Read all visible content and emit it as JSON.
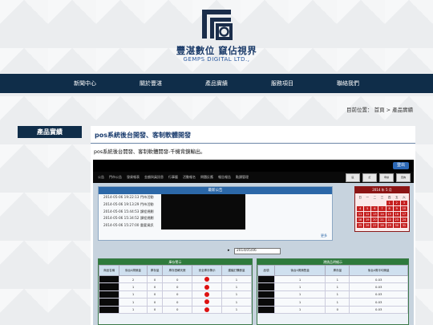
{
  "brand": {
    "name_zh": "豐湛數位 竄佔視界",
    "name_en": "GEMPS DIGITAL LTD.,"
  },
  "nav": [
    {
      "label": "新聞中心"
    },
    {
      "label": "關於豐湛"
    },
    {
      "label": "產品實績"
    },
    {
      "label": "服務項目"
    },
    {
      "label": "聯絡我們"
    }
  ],
  "breadcrumb": "目前位置： 首頁 > 產品實績",
  "sidebar": {
    "title": "產品實績"
  },
  "article": {
    "title": "pos系統後台開發、客制軟體開發",
    "description": "pos系統後台開發、客制軟體開發-千機背鏡輸出。"
  },
  "screenshot": {
    "top_button": "登出",
    "menu": [
      "公告",
      "門市公告",
      "發貨報表",
      "金額與員訊息",
      "行事曆",
      "活動報名",
      "問題反應",
      "報告報告",
      "點讀管理"
    ],
    "menu_icons": [
      "區",
      "訂",
      "申請",
      "查詢"
    ],
    "news": {
      "heading": "最新公告",
      "rows": [
        {
          "time": "2014-05-06 19:22:13",
          "type": "門市活動"
        },
        {
          "time": "2014-05-06 19:13:29",
          "type": "門市活動"
        },
        {
          "time": "2014-05-06 15:44:53",
          "type": "課程規劃"
        },
        {
          "time": "2014-05-06 15:34:52",
          "type": "課程規劃"
        },
        {
          "time": "2014-05-06 15:27:00",
          "type": "重要資訊"
        }
      ],
      "more": "更多"
    },
    "calendar": {
      "heading": "2014 年 5 月",
      "weekdays": [
        "日",
        "一",
        "二",
        "三",
        "四",
        "五",
        "六"
      ],
      "days": [
        "",
        "",
        "",
        "",
        "1",
        "2",
        "3",
        "4",
        "5",
        "6",
        "7",
        "8",
        "9",
        "10",
        "11",
        "12",
        "13",
        "14",
        "15",
        "16",
        "17",
        "18",
        "19",
        "20",
        "21",
        "22",
        "23",
        "24",
        "25",
        "26",
        "27",
        "28",
        "29",
        "30",
        "31"
      ]
    },
    "date_value": "2014/05/06",
    "stock": {
      "heading": "庫存警示",
      "headers": [
        "商品名稱",
        "後台4周銷量",
        "庫存量",
        "庫存週轉天數",
        "安全庫存警示",
        "建議訂購數量"
      ],
      "rows": [
        {
          "a": "2",
          "b": "0",
          "c": "0",
          "d": "1"
        },
        {
          "a": "1",
          "b": "0",
          "c": "0",
          "d": "1"
        },
        {
          "a": "1",
          "b": "0",
          "c": "0",
          "d": "1"
        },
        {
          "a": "1",
          "b": "0",
          "c": "0",
          "d": "1"
        },
        {
          "a": "1",
          "b": "0",
          "c": "0",
          "d": "1"
        }
      ]
    },
    "sales": {
      "heading": "滯銷品明細示",
      "headers": [
        "品項",
        "後台4周銷售量",
        "庫存量",
        "後台4周平均銷量"
      ],
      "rows": [
        {
          "a": "1",
          "b": "1",
          "c": "0.03"
        },
        {
          "a": "1",
          "b": "1",
          "c": "0.03"
        },
        {
          "a": "1",
          "b": "1",
          "c": "0.03"
        },
        {
          "a": "1",
          "b": "1",
          "c": "0.03"
        },
        {
          "a": "1",
          "b": "0",
          "c": "0.03"
        }
      ]
    }
  }
}
